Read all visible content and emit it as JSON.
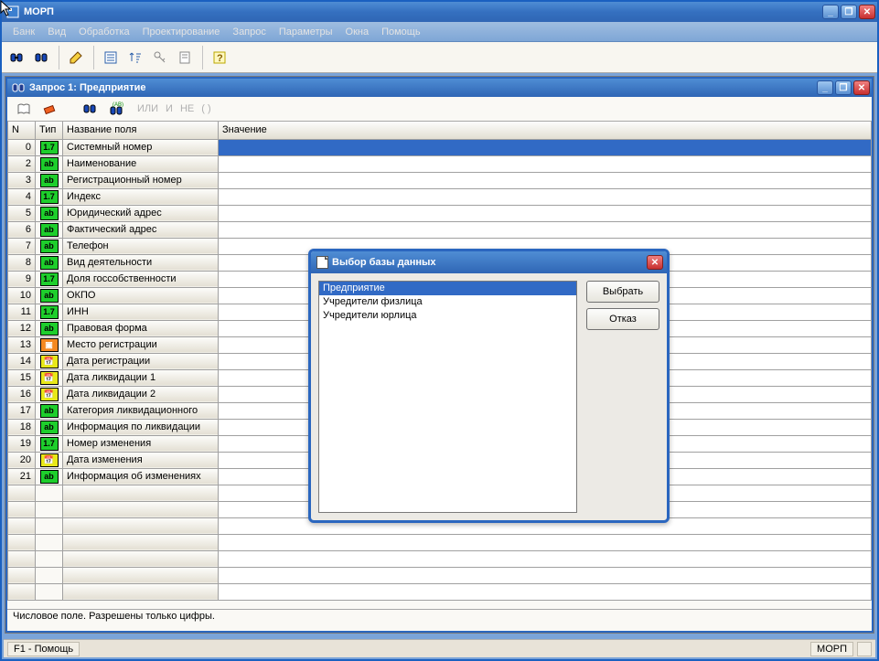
{
  "app": {
    "title": "МОРП"
  },
  "menu": [
    "Банк",
    "Вид",
    "Обработка",
    "Проектирование",
    "Запрос",
    "Параметры",
    "Окна",
    "Помощь"
  ],
  "child_window": {
    "title": "Запрос 1: Предприятие",
    "ops": [
      "ИЛИ",
      "И",
      "НЕ",
      "(  )"
    ]
  },
  "columns": {
    "n": "N",
    "type": "Тип",
    "name": "Название поля",
    "value": "Значение"
  },
  "rows": [
    {
      "n": "0",
      "type": "1.7",
      "kind": "17",
      "name": "Системный номер"
    },
    {
      "n": "2",
      "type": "ab",
      "kind": "ab",
      "name": "Наименование"
    },
    {
      "n": "3",
      "type": "ab",
      "kind": "ab",
      "name": "Регистрационный номер"
    },
    {
      "n": "4",
      "type": "1.7",
      "kind": "17",
      "name": "Индекс"
    },
    {
      "n": "5",
      "type": "ab",
      "kind": "ab",
      "name": "Юридический адрес"
    },
    {
      "n": "6",
      "type": "ab",
      "kind": "ab",
      "name": "Фактический адрес"
    },
    {
      "n": "7",
      "type": "ab",
      "kind": "ab",
      "name": "Телефон"
    },
    {
      "n": "8",
      "type": "ab",
      "kind": "ab",
      "name": "Вид деятельности"
    },
    {
      "n": "9",
      "type": "1.7",
      "kind": "17",
      "name": "Доля госсобственности"
    },
    {
      "n": "10",
      "type": "ab",
      "kind": "ab",
      "name": "ОКПО"
    },
    {
      "n": "11",
      "type": "1.7",
      "kind": "17",
      "name": "ИНН"
    },
    {
      "n": "12",
      "type": "ab",
      "kind": "ab",
      "name": "Правовая форма"
    },
    {
      "n": "13",
      "type": "▣",
      "kind": "list",
      "name": "Место регистрации"
    },
    {
      "n": "14",
      "type": "📅",
      "kind": "date",
      "name": "Дата регистрации"
    },
    {
      "n": "15",
      "type": "📅",
      "kind": "date",
      "name": "Дата ликвидации 1"
    },
    {
      "n": "16",
      "type": "📅",
      "kind": "date",
      "name": "Дата ликвидации 2"
    },
    {
      "n": "17",
      "type": "ab",
      "kind": "ab",
      "name": "Категория ликвидационного"
    },
    {
      "n": "18",
      "type": "ab",
      "kind": "ab",
      "name": "Информация по ликвидации"
    },
    {
      "n": "19",
      "type": "1.7",
      "kind": "17",
      "name": "Номер изменения"
    },
    {
      "n": "20",
      "type": "📅",
      "kind": "date",
      "name": "Дата изменения"
    },
    {
      "n": "21",
      "type": "ab",
      "kind": "ab",
      "name": "Информация об изменениях"
    }
  ],
  "help_line": "Числовое поле. Разрешены только цифры.",
  "dialog": {
    "title": "Выбор базы данных",
    "items": [
      "Предприятие",
      "Учредители физлица",
      "Учредители юрлица"
    ],
    "btn_select": "Выбрать",
    "btn_cancel": "Отказ"
  },
  "status": {
    "left": "F1 - Помощь",
    "right": "МОРП"
  }
}
